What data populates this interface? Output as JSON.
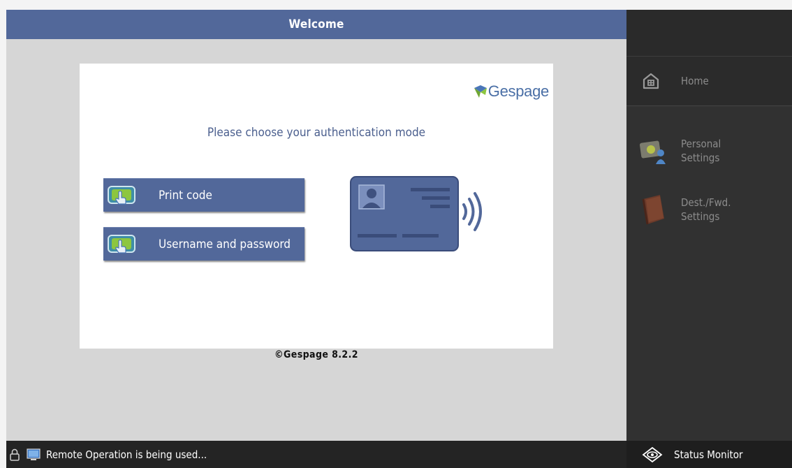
{
  "header": {
    "title": "Welcome"
  },
  "login": {
    "logo_text": "Gespage",
    "prompt": "Please choose your authentication mode",
    "buttons": [
      {
        "label": "Print code",
        "icon": "touch-screen-icon"
      },
      {
        "label": "Username and password",
        "icon": "touch-screen-icon"
      }
    ],
    "illustration": "id-card-contactless-icon",
    "version": "©Gespage 8.2.2"
  },
  "sidebar": {
    "home": {
      "label": "Home",
      "icon": "home-icon"
    },
    "items": [
      {
        "label": "Personal Settings",
        "line1": "Personal",
        "line2": "Settings",
        "icon": "personal-settings-icon"
      },
      {
        "label": "Dest./Fwd. Settings",
        "line1": "Dest./Fwd.",
        "line2": "Settings",
        "icon": "address-book-icon"
      }
    ]
  },
  "statusbar": {
    "message": "Remote Operation is being used...",
    "status_monitor_label": "Status Monitor"
  },
  "colors": {
    "accent": "#52689a",
    "panel_bg": "#d6d6d6",
    "sidebar_bg": "#313131",
    "statusbar_bg": "#242424",
    "text_blue": "#4b5f8e"
  }
}
